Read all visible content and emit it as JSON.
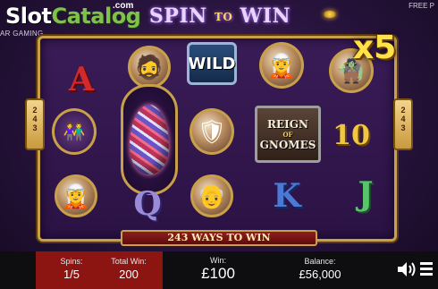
{
  "brand": {
    "slot": "Slot",
    "catalog": "Catalog",
    "com": ".com"
  },
  "provider": "AR GAMING",
  "top_right": "FREE P",
  "game_logo": {
    "part1": "SPIN",
    "part2": "TO",
    "part3": "WIN"
  },
  "multiplier": "x5",
  "ways_tab": {
    "left": "2\n4\n3",
    "right": "2\n4\n3"
  },
  "reels": {
    "ace": "A",
    "wild": "WILD",
    "reign": {
      "line1": "REIGN",
      "line2": "OF",
      "line3": "GNOMES"
    },
    "ten": "10",
    "queen": "Q",
    "king": "K",
    "jack": "J"
  },
  "ways_banner": "243 WAYS TO WIN",
  "bottom_bar": {
    "spins_label": "Spins:",
    "spins_value": "1/5",
    "total_win_label": "Total Win:",
    "total_win_value": "200",
    "win_label": "Win:",
    "win_value": "£100",
    "balance_label": "Balance:",
    "balance_value": "£56,000"
  },
  "colors": {
    "accent_gold": "#c9a04a",
    "spins_panel": "#8c1512",
    "brand_green": "#7fc24a",
    "multiplier_yellow": "#ffe24a"
  }
}
